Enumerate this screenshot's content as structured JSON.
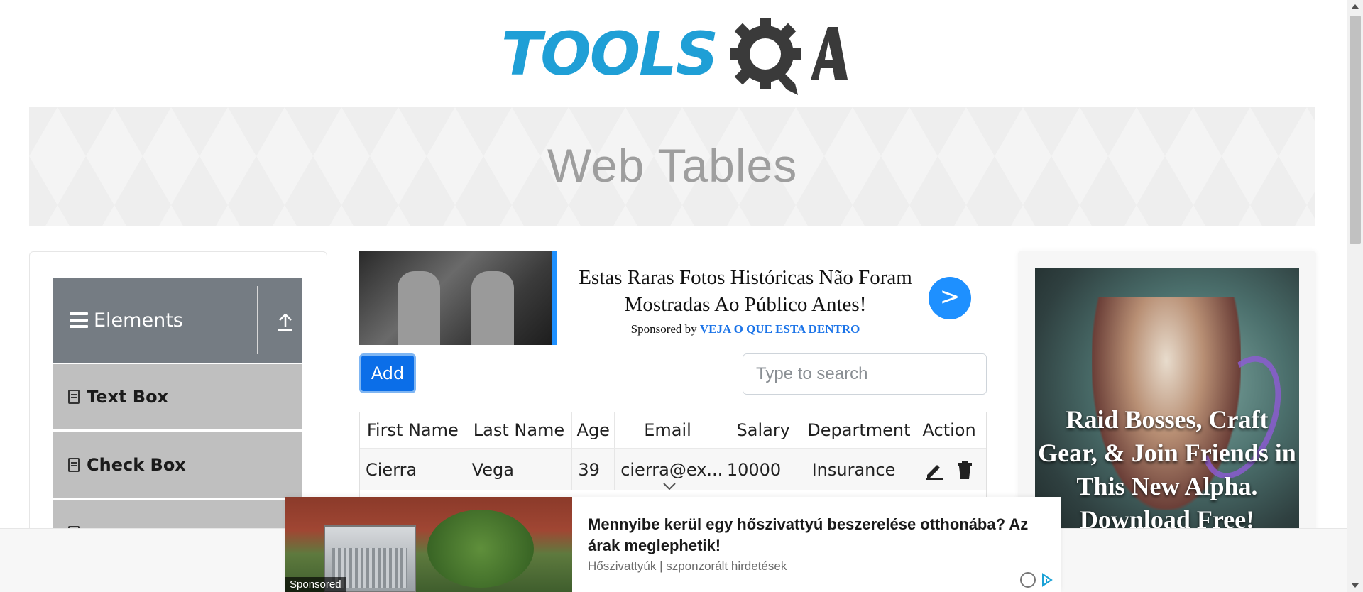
{
  "logo": {
    "brand_text": "TOOLS",
    "brand_suffix": "QA"
  },
  "banner": {
    "title": "Web Tables"
  },
  "sidebar": {
    "group_label": "Elements",
    "items": [
      {
        "label": "Text Box"
      },
      {
        "label": "Check Box"
      }
    ]
  },
  "top_ad": {
    "headline": "Estas Raras Fotos Históricas Não Foram Mostradas Ao Público Antes!",
    "sponsored_prefix": "Sponsored by",
    "sponsor": "VEJA O QUE ESTA DENTRO",
    "cta": ">"
  },
  "toolbar": {
    "add_label": "Add",
    "search_placeholder": "Type to search"
  },
  "table": {
    "columns": [
      "First Name",
      "Last Name",
      "Age",
      "Email",
      "Salary",
      "Department",
      "Action"
    ],
    "rows": [
      {
        "first_name": "Cierra",
        "last_name": "Vega",
        "age": "39",
        "email": "cierra@ex...",
        "salary": "10000",
        "department": "Insurance"
      }
    ]
  },
  "right_ad": {
    "text": "Raid Bosses, Craft Gear, & Join Friends in This New Alpha. Download Free!"
  },
  "bottom_ad": {
    "tag": "Sponsored",
    "title": "Mennyibe kerül egy hőszivattyú beszerelése otthonába? Az árak meglephetik!",
    "source": "Hőszivattyúk | szponzorált hirdetések"
  },
  "colors": {
    "brand_blue": "#1f9fd6",
    "brand_dark": "#3a3a3a",
    "primary_button": "#0b6ee8",
    "sidebar_header": "#757c83",
    "sidebar_item": "#bfbfbf"
  }
}
